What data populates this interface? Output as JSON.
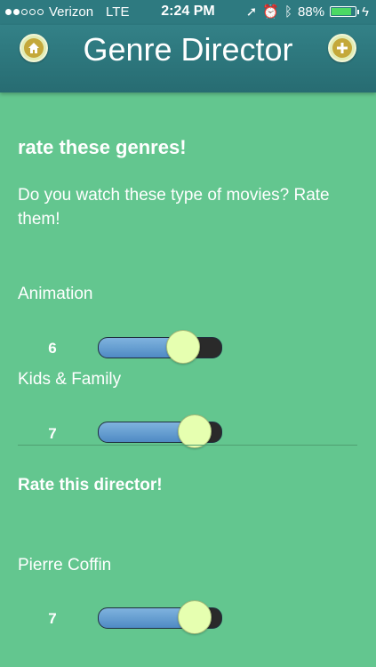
{
  "status_bar": {
    "carrier": "Verizon",
    "network": "LTE",
    "time": "2:24 PM",
    "battery": "88%",
    "battery_level": 0.88
  },
  "nav": {
    "title": "Genre Director",
    "home_icon": "home-icon",
    "add_icon": "plus-icon"
  },
  "colors": {
    "background": "#63c68f",
    "navbar": "#2e7a80",
    "slider_fill": "#5b95cc",
    "slider_thumb": "#e6ffb0"
  },
  "genres_section": {
    "heading": "rate these genres!",
    "description": "Do you watch these type of movies? Rate them!",
    "items": [
      {
        "label": "Animation",
        "value": "6",
        "level": 0.6
      },
      {
        "label": "Kids & Family",
        "value": "7",
        "level": 0.7
      }
    ]
  },
  "director_section": {
    "heading": "Rate this director!",
    "items": [
      {
        "label": "Pierre Coffin",
        "value": "7",
        "level": 0.7
      }
    ]
  }
}
